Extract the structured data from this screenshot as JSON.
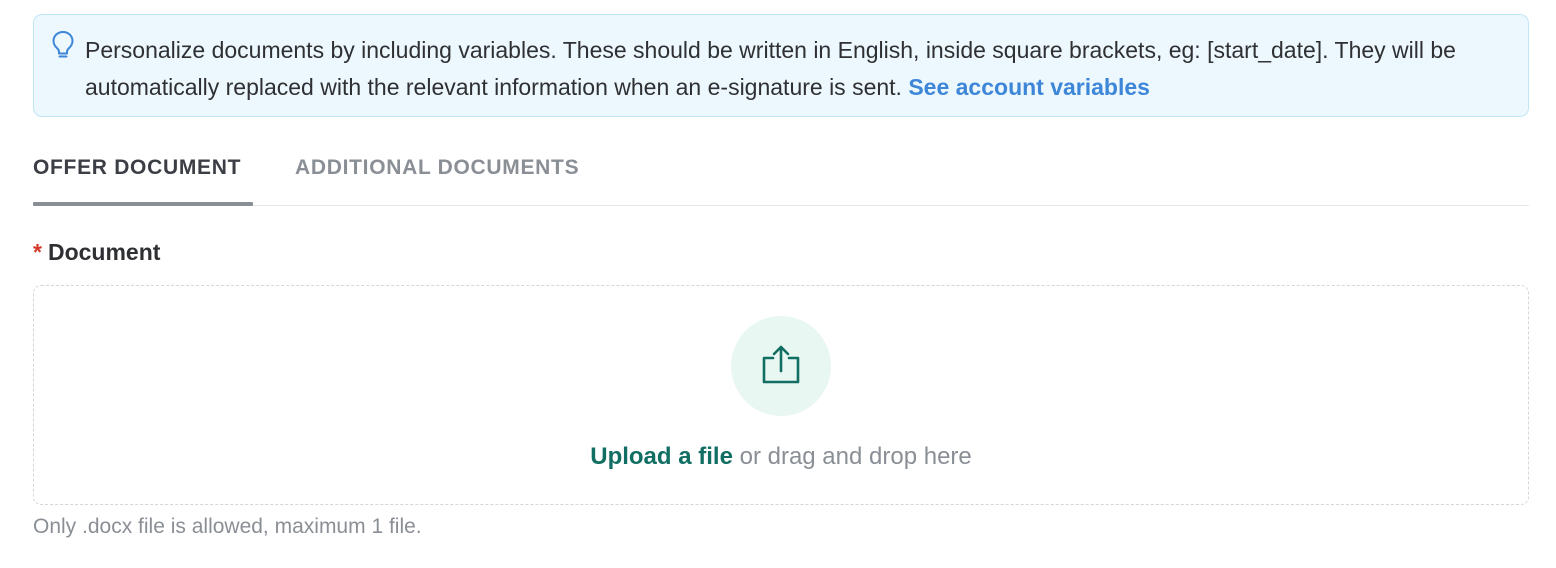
{
  "banner": {
    "icon": "lightbulb-icon",
    "text_before_link": "Personalize documents by including variables. These should be written in English, inside square brackets, eg: [start_date]. They will be automatically replaced with the relevant information when an e-signature is sent. ",
    "link": "See account variables",
    "colors": {
      "background": "#ecf8fd",
      "border": "#bfe6f5",
      "link": "#3d86d8"
    }
  },
  "tabs": [
    {
      "label": "OFFER DOCUMENT",
      "active": true
    },
    {
      "label": "ADDITIONAL DOCUMENTS",
      "active": false
    }
  ],
  "document_field": {
    "required_marker": "*",
    "label": "Document",
    "dropzone": {
      "icon": "upload-icon",
      "upload_link": "Upload a file",
      "drag_text": " or drag and drop here"
    },
    "hint": "Only .docx file is allowed, maximum 1 file."
  },
  "colors": {
    "accent": "#106e62",
    "required": "#d43a2a"
  }
}
